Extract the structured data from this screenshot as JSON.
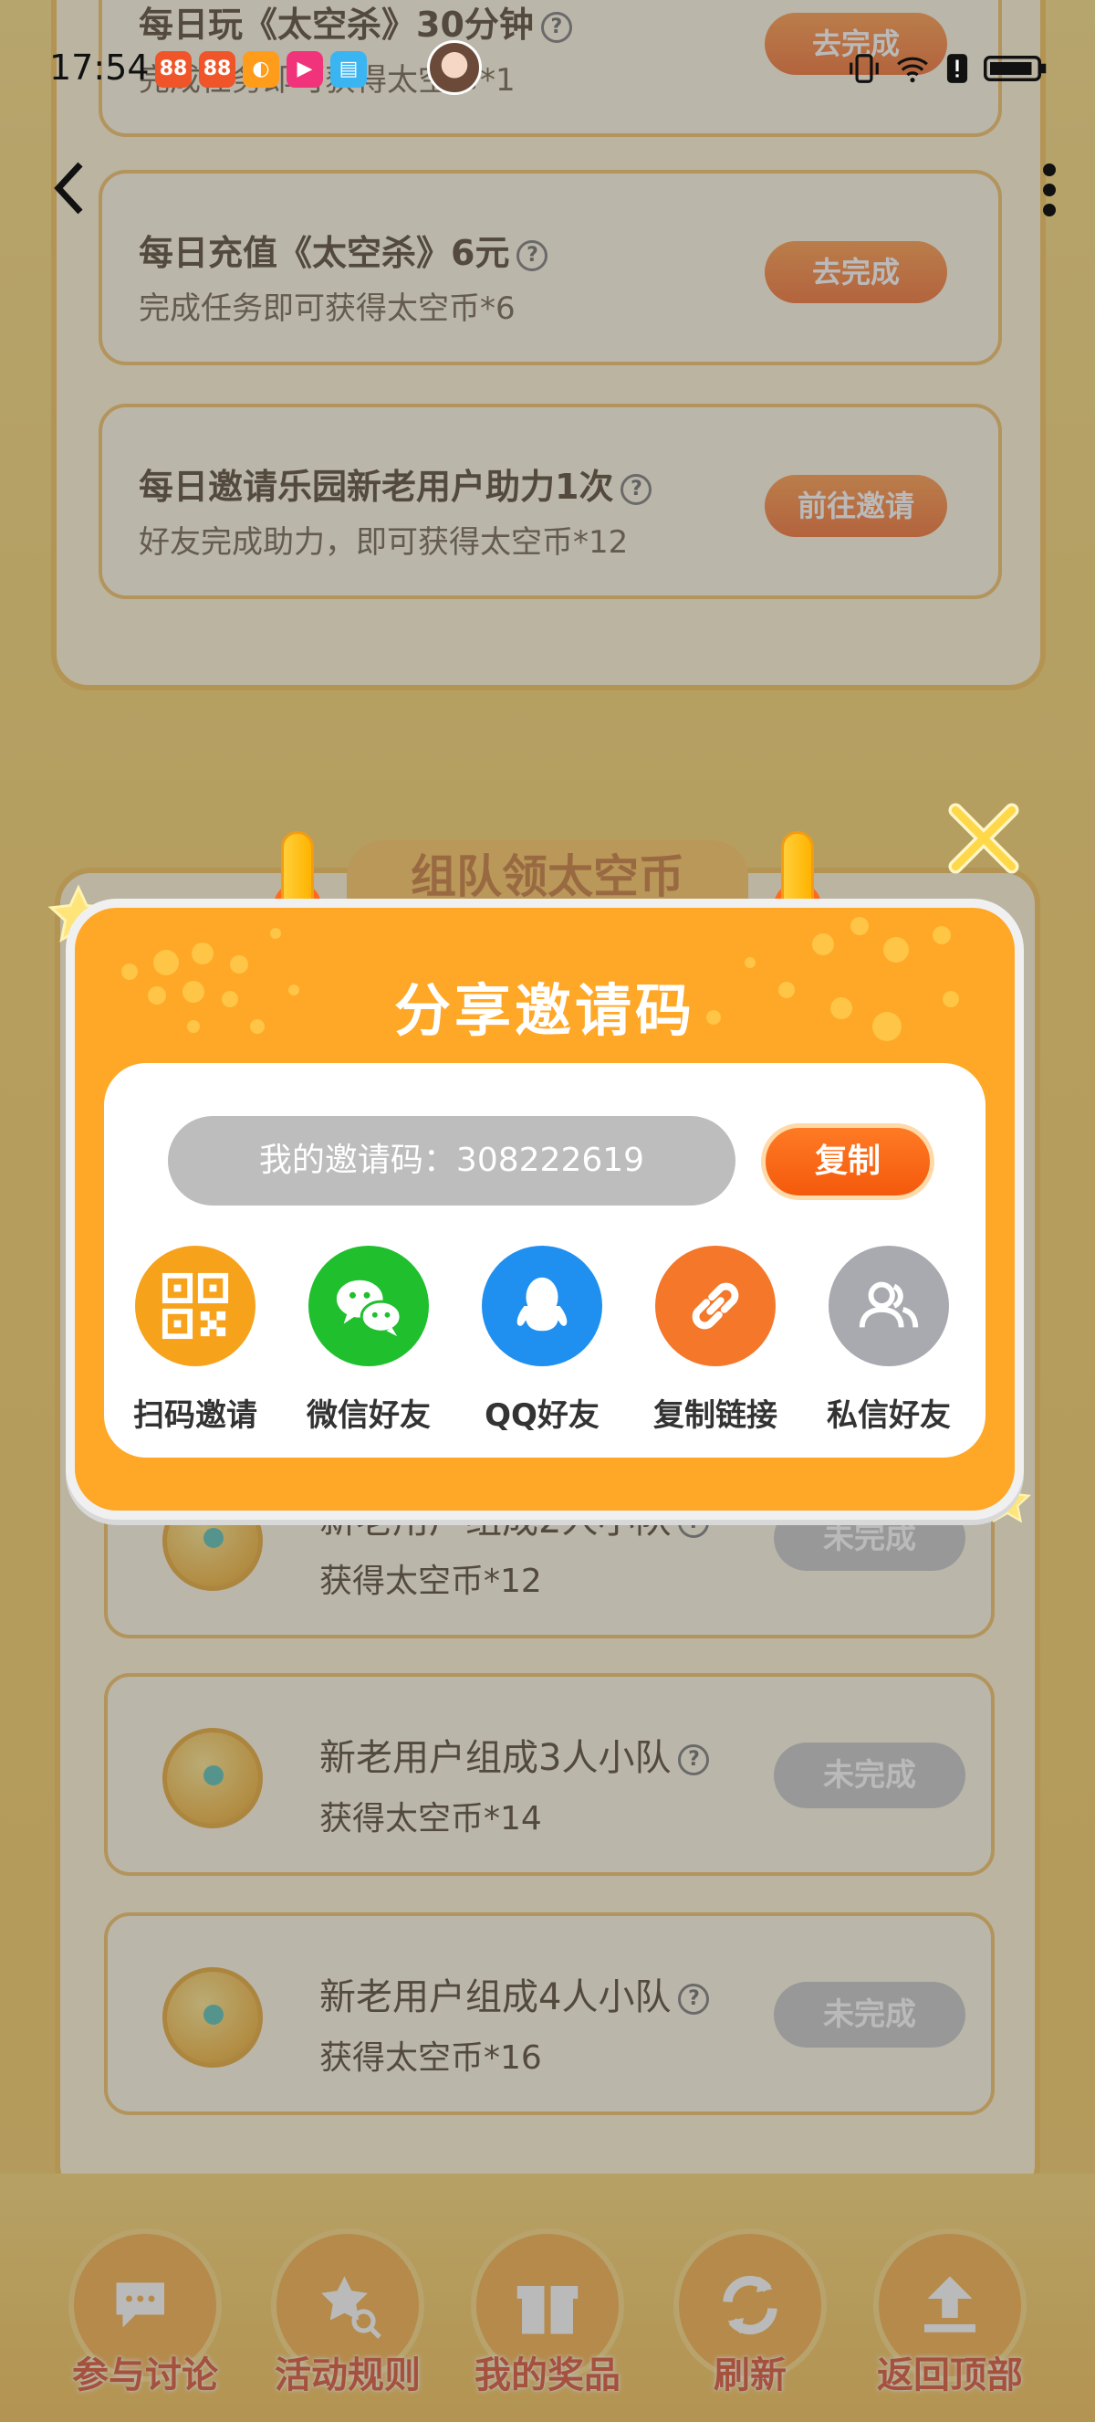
{
  "status_bar": {
    "time": "17:54",
    "apps": [
      {
        "name": "app-icon-1",
        "color": "#f0552a",
        "glyph": "88"
      },
      {
        "name": "app-icon-2",
        "color": "#f0552a",
        "glyph": "88"
      },
      {
        "name": "app-icon-3",
        "color": "#ff9c1a",
        "glyph": "◐"
      },
      {
        "name": "app-icon-4",
        "color": "#f0337a",
        "glyph": "▶"
      },
      {
        "name": "app-icon-5",
        "color": "#3bb4f2",
        "glyph": "▤"
      }
    ]
  },
  "tasks": [
    {
      "title": "每日玩《太空杀》30分钟",
      "subtitle": "完成任务即可获得太空币*1",
      "button": "去完成"
    },
    {
      "title": "每日充值《太空杀》6元",
      "subtitle": "完成任务即可获得太空币*6",
      "button": "去完成"
    },
    {
      "title": "每日邀请乐园新老用户助力1次",
      "subtitle": "好友完成助力，即可获得太空币*12",
      "button": "前往邀请"
    }
  ],
  "team_section": {
    "header": "组队领太空币",
    "cards": [
      {
        "title": "新老用户组成2人小队",
        "subtitle": "获得太空币*12",
        "button": "未完成"
      },
      {
        "title": "新老用户组成3人小队",
        "subtitle": "获得太空币*14",
        "button": "未完成"
      },
      {
        "title": "新老用户组成4人小队",
        "subtitle": "获得太空币*16",
        "button": "未完成"
      }
    ]
  },
  "bottom_nav": [
    "参与讨论",
    "活动规则",
    "我的奖品",
    "刷新",
    "返回顶部"
  ],
  "modal": {
    "title": "分享邀请码",
    "code_text": "我的邀请码：308222619",
    "copy_button": "复制",
    "share_options": [
      {
        "label": "扫码邀请",
        "color": "#f7a21b"
      },
      {
        "label": "微信好友",
        "color": "#1fbf2e"
      },
      {
        "label": "QQ好友",
        "color": "#1f8ff0"
      },
      {
        "label": "复制链接",
        "color": "#f4772a"
      },
      {
        "label": "私信好友",
        "color": "#a9a9b0"
      }
    ]
  }
}
